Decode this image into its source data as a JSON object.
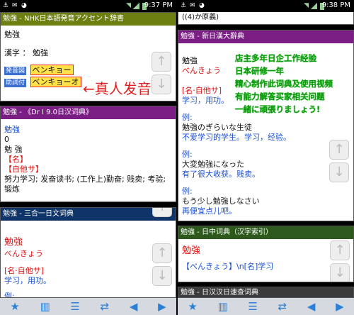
{
  "left": {
    "status": {
      "time": "9:37 PM"
    },
    "card1": {
      "header": "勉強 - NHK日本語発音アクセント辞書",
      "word": "勉強",
      "kanji_line": "漢字 ： 勉強",
      "tag1": "発音図",
      "reading1": "ベンキョー",
      "tag2": "助詞付",
      "reading2": "ベンキョーオ",
      "annotation": "←真人发音"
    },
    "card2": {
      "header": "勉強 - 《Dr I 9.0日汉词典》",
      "word": "勉強",
      "num": "0",
      "line2": "勉 強",
      "pos1": "【名】",
      "pos2": "【自他サ】",
      "meaning": "努力学习; 发奋读书; (工作上)勤奋; 贱卖; 考验; 锻炼"
    },
    "card3": {
      "header": "勉強 - 三合一日文词典",
      "word": "勉強",
      "reading": "べんきょう",
      "pos": "[名·自他サ]",
      "meaning": "学习，用功。",
      "example_label": "例:"
    }
  },
  "right": {
    "status": {
      "time": "9:38 PM"
    },
    "topline": "((4)か原義)",
    "card1": {
      "header": "勉強 - 新日漢大辭典",
      "word": "勉強",
      "reading": "べんきょう",
      "pos": "[名·自他サ]",
      "meaning": "学习，用功。",
      "ex_label": "例:",
      "ex1_jp": "勉強のぎらいな生徒",
      "ex1_cn": "不爱学习的学生。学习，经验。",
      "ex2_jp": "大変勉強になった",
      "ex2_cn": "有了很大收获。贱卖。",
      "ex3_jp": "もう少し勉強しなさい",
      "ex3_cn": "再便宜点儿吧。",
      "promo": [
        "店主多年日企工作经验",
        "日本研修一年",
        "精心制作此词典及使用视频",
        "有能力解答买家相关问题",
        "一緒に頑張りましょう!"
      ]
    },
    "card2": {
      "header": "勉強 - 日中词典（汉字索引）",
      "word": "勉強",
      "entry": "【べんきょう】\\n[名]学习"
    },
    "card3": {
      "header": "勉強 - 日汉汉日速查词典"
    }
  },
  "icons": [
    "star-icon",
    "library-icon",
    "list-icon",
    "repeat-icon",
    "back-icon",
    "forward-icon"
  ],
  "colors": {
    "olive": "#6d7f10",
    "purple": "#7a1e84",
    "navy": "#0e3468",
    "darkgreen": "#2d5a1c",
    "red": "#e01010",
    "blue": "#1a4fd0"
  }
}
